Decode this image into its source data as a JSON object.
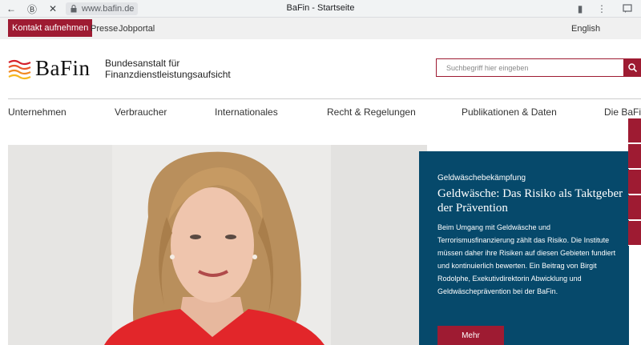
{
  "browser": {
    "url": "www.bafin.de",
    "tab_title": "BaFin - Startseite",
    "back_glyph": "←",
    "profile_glyph": "Ⓑ",
    "close_glyph": "✕",
    "bookmark_glyph": "▮",
    "menu_glyph": "⋮"
  },
  "servicebar": {
    "contact_label": "Kontakt aufnehmen",
    "links": [
      "Presse",
      "Jobportal"
    ],
    "language": "English"
  },
  "header": {
    "logo_text": "BaFin",
    "tagline_line1": "Bundesanstalt für",
    "tagline_line2": "Finanzdienstleistungsaufsicht",
    "search_placeholder": "Suchbegriff hier eingeben"
  },
  "mainnav": {
    "items": [
      "Unternehmen",
      "Verbraucher",
      "Internationales",
      "Recht & Regelungen",
      "Publikationen & Daten",
      "Die BaFin"
    ]
  },
  "teaser": {
    "kicker": "Geldwäschebekämpfung",
    "headline": "Geldwäsche: Das Risiko als Taktgeber der Prävention",
    "body": "Beim Umgang mit Geldwäsche und Terrorismusfinanzierung zählt das Risiko. Die Institute müssen daher ihre Risiken auf diesen Gebieten fundiert und kontinuierlich bewerten. Ein Beitrag von Birgit Rodolphe, Exekutivdirektorin Abwicklung und Geldwäscheprävention bei der BaFin.",
    "more_label": "Mehr"
  },
  "colors": {
    "brand_red": "#9e1b32",
    "teaser_blue": "#06496b",
    "service_gray": "#f0f0f0"
  },
  "icons": {
    "search": "search-icon",
    "logo_mark": "bafin-wave-logo-icon"
  }
}
